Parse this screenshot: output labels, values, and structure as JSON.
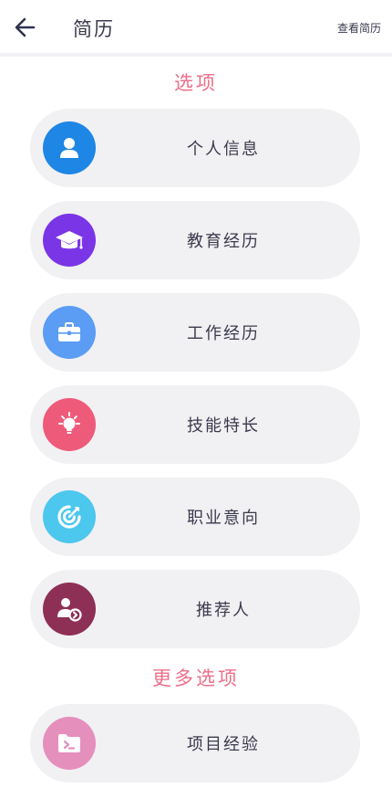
{
  "header": {
    "title": "简历",
    "view_resume_label": "查看简历",
    "back_icon": "arrow-left-icon"
  },
  "sections": {
    "options_heading": "选项",
    "more_options_heading": "更多选项"
  },
  "options": [
    {
      "label": "个人信息",
      "icon": "person-icon",
      "color": "#1e86e4"
    },
    {
      "label": "教育经历",
      "icon": "graduation-cap-icon",
      "color": "#7a35e6"
    },
    {
      "label": "工作经历",
      "icon": "briefcase-icon",
      "color": "#5b9cf4"
    },
    {
      "label": "技能特长",
      "icon": "lightbulb-icon",
      "color": "#ee5a7a"
    },
    {
      "label": "职业意向",
      "icon": "target-icon",
      "color": "#4cc7ee"
    },
    {
      "label": "推荐人",
      "icon": "user-referral-icon",
      "color": "#8e2f56"
    }
  ],
  "more_options": [
    {
      "label": "项目经验",
      "icon": "folder-code-icon",
      "color": "#e58fbd"
    }
  ],
  "colors": {
    "accent": "#ee6f8a",
    "card_bg": "#f1f0f2",
    "text": "#3a3a4e"
  }
}
